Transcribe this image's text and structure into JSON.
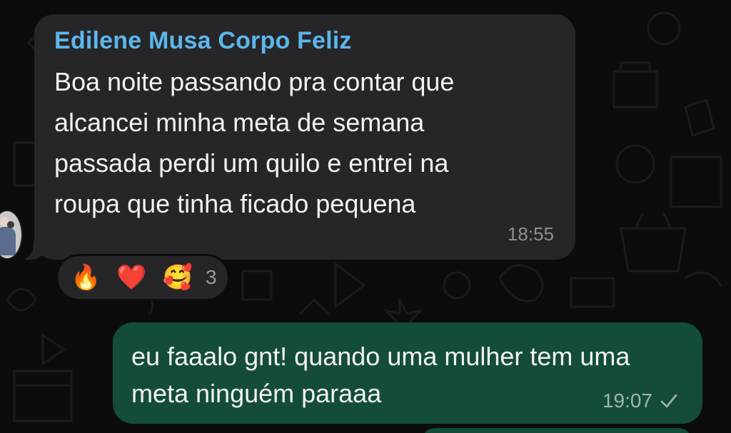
{
  "incoming": {
    "sender": "Edilene Musa Corpo Feliz",
    "text": "Boa noite passando pra contar que\nalcancei minha meta de semana\npassada perdi um quilo e entrei na\nroupa que tinha ficado pequena",
    "time": "18:55",
    "sender_color": "#5cb6ec",
    "reactions": [
      "🔥",
      "❤️",
      "🥰"
    ],
    "reaction_count": "3"
  },
  "outgoing": {
    "text": "eu faaalo gnt! quando uma mulher tem uma meta ninguém paraaa",
    "time": "19:07",
    "status_icon": "single-check-icon",
    "bubble_color": "#144d37"
  }
}
